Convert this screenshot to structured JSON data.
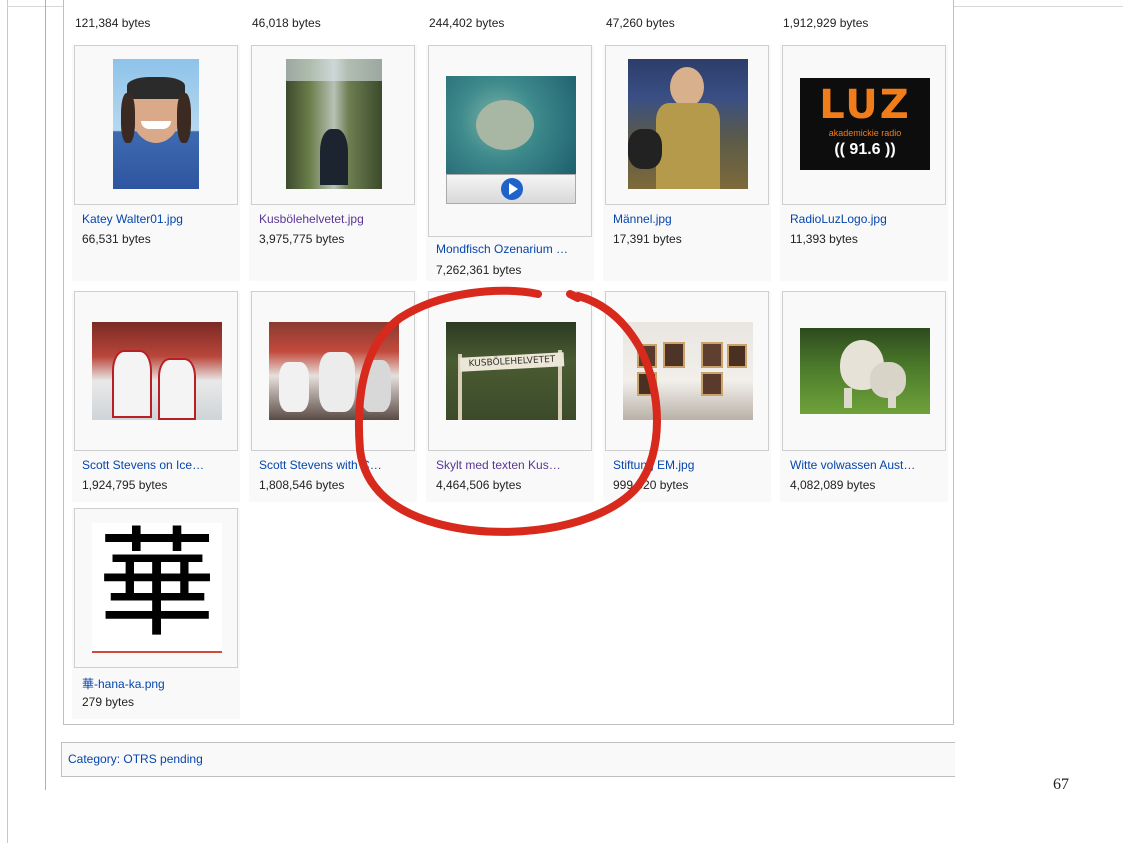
{
  "gallery": {
    "row0": [
      {
        "size": "121,384 bytes"
      },
      {
        "size": "46,018 bytes"
      },
      {
        "size": "244,402 bytes"
      },
      {
        "size": "47,260 bytes"
      },
      {
        "size": "1,912,929 bytes"
      }
    ],
    "row1": [
      {
        "name": "Katey Walter01.jpg",
        "size": "66,531 bytes"
      },
      {
        "name": "Kusbölehelvetet.jpg",
        "size": "3,975,775 bytes"
      },
      {
        "name": "Mondfisch Ozenarium …",
        "size": "7,262,361 bytes"
      },
      {
        "name": "Männel.jpg",
        "size": "17,391 bytes"
      },
      {
        "name": "RadioLuzLogo.jpg",
        "size": "11,393 bytes"
      }
    ],
    "row2": [
      {
        "name": "Scott Stevens on Ice…",
        "size": "1,924,795 bytes"
      },
      {
        "name": "Scott Stevens with C…",
        "size": "1,808,546 bytes"
      },
      {
        "name": "Skylt med texten Kus…",
        "size": "4,464,506 bytes"
      },
      {
        "name": "Stiftung EM.jpg",
        "size": "999,020 bytes"
      },
      {
        "name": "Witte volwassen Aust…",
        "size": "4,082,089 bytes"
      }
    ],
    "row3": [
      {
        "name": "華-hana-ka.png",
        "size": "279 bytes"
      }
    ]
  },
  "thumbnails": {
    "luz_logo_text": "LUZ",
    "luz_subtitle": "akademickie radio",
    "luz_freq": "(( 91.6 ))",
    "sign_text": "KUSBÖLEHELVETET",
    "kanji": "華"
  },
  "category": {
    "label": "Category: OTRS pending"
  },
  "page_number": "67",
  "colors": {
    "link": "#0645ad",
    "visited_link": "#5a3696",
    "annotation": "#d8291d"
  }
}
